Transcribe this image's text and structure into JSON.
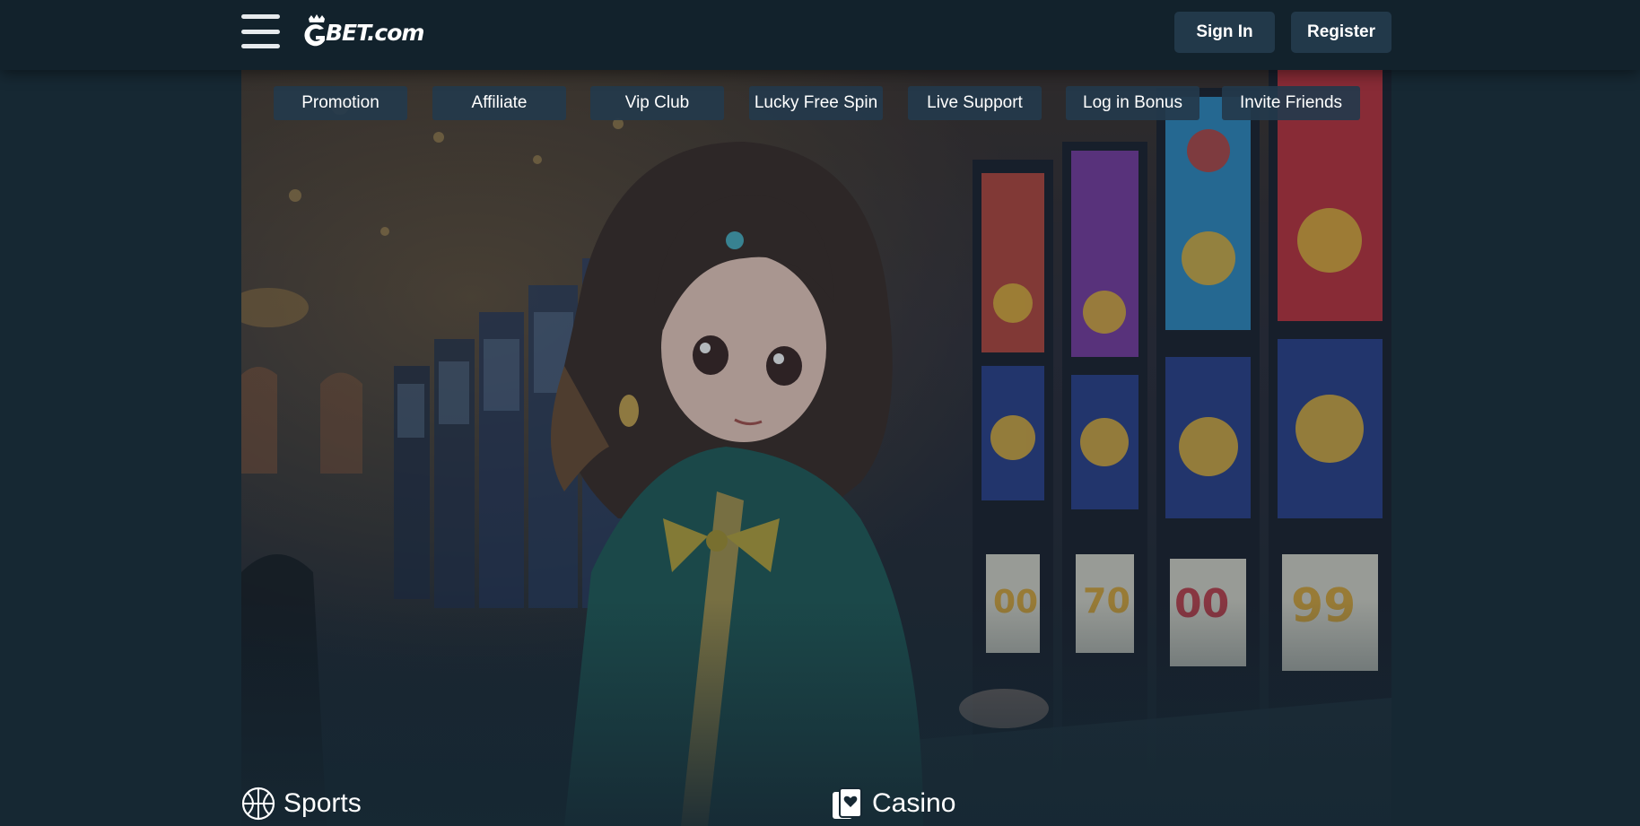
{
  "header": {
    "logo_text": "BET.com",
    "sign_in_label": "Sign In",
    "register_label": "Register"
  },
  "nav": {
    "items": [
      {
        "label": "Promotion"
      },
      {
        "label": "Affiliate"
      },
      {
        "label": "Vip Club"
      },
      {
        "label": "Lucky Free Spin"
      },
      {
        "label": "Live Support"
      },
      {
        "label": "Log in Bonus"
      },
      {
        "label": "Invite Friends"
      }
    ]
  },
  "sections": {
    "sports_label": "Sports",
    "casino_label": "Casino"
  },
  "icons": {
    "menu": "hamburger-menu-icon",
    "logo": "crown-g-logo-icon",
    "sports": "basketball-icon",
    "casino": "playing-card-icon"
  },
  "colors": {
    "background": "#162833",
    "topbar": "#12222c",
    "button": "#22394a"
  }
}
